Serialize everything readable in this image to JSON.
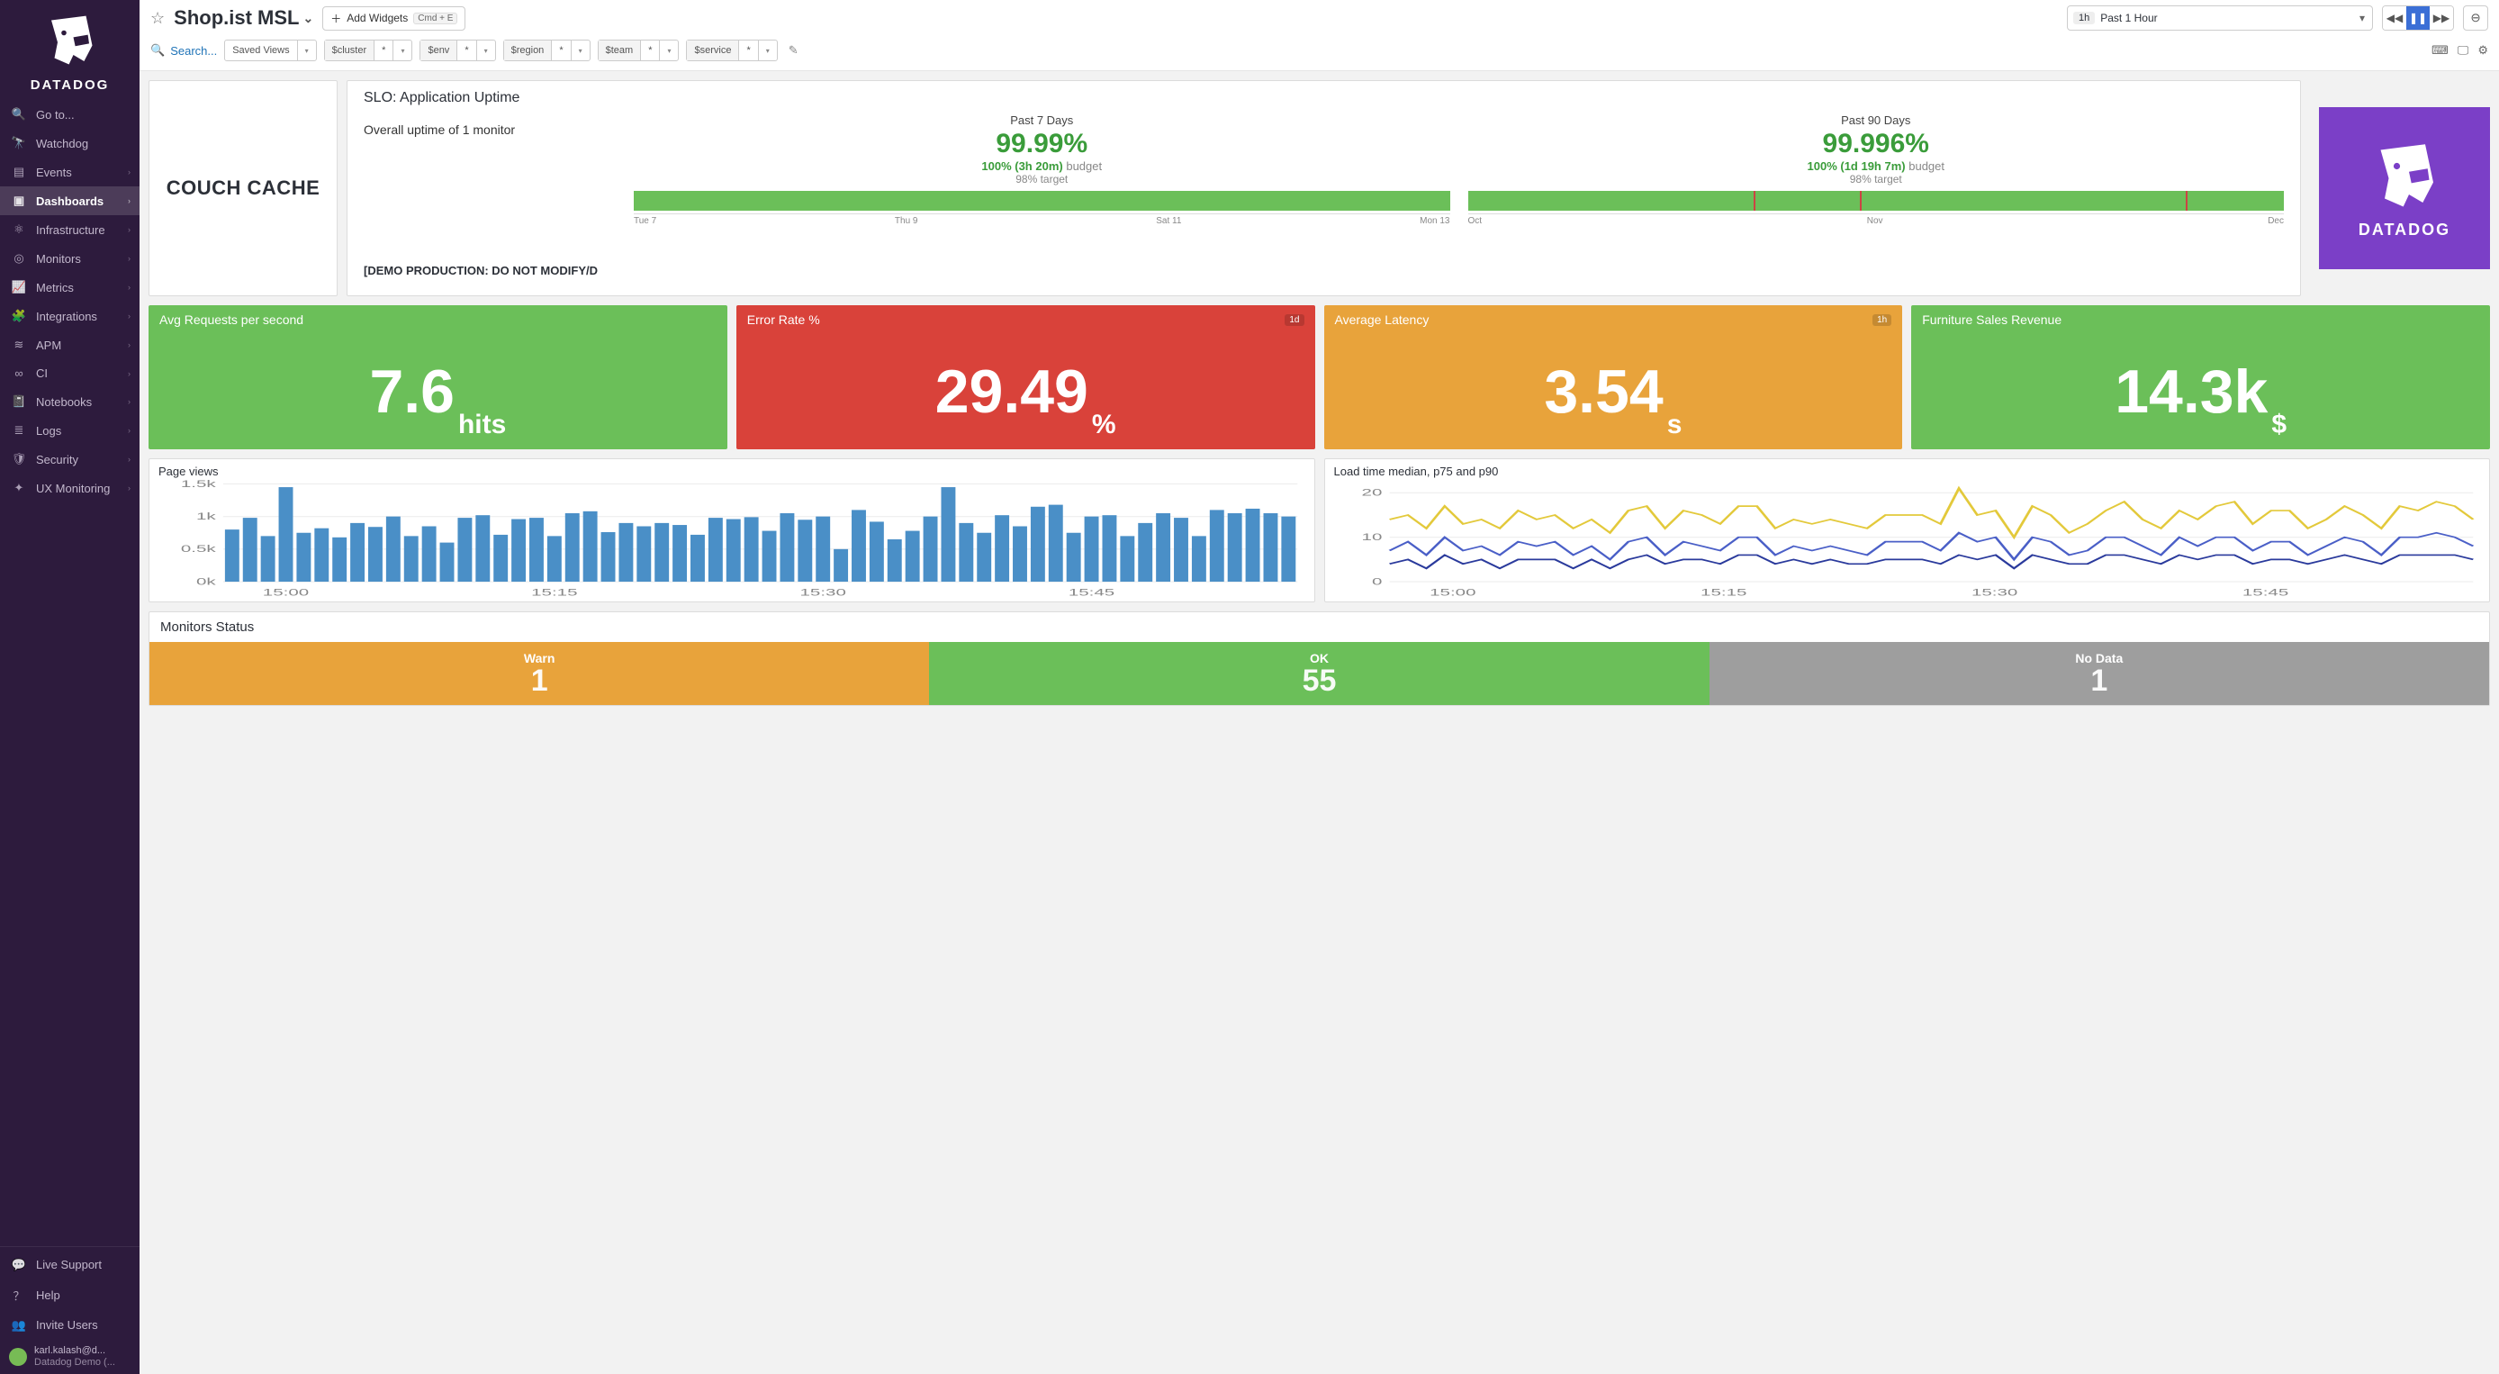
{
  "brand": "DATADOG",
  "sidebar": {
    "items": [
      {
        "label": "Go to...",
        "icon": "search",
        "chev": false
      },
      {
        "label": "Watchdog",
        "icon": "binoculars",
        "chev": false
      },
      {
        "label": "Events",
        "icon": "list",
        "chev": true
      },
      {
        "label": "Dashboards",
        "icon": "dashboard",
        "chev": true,
        "active": true
      },
      {
        "label": "Infrastructure",
        "icon": "infra",
        "chev": true
      },
      {
        "label": "Monitors",
        "icon": "monitor",
        "chev": true
      },
      {
        "label": "Metrics",
        "icon": "metrics",
        "chev": true
      },
      {
        "label": "Integrations",
        "icon": "puzzle",
        "chev": true
      },
      {
        "label": "APM",
        "icon": "apm",
        "chev": true
      },
      {
        "label": "CI",
        "icon": "ci",
        "chev": true
      },
      {
        "label": "Notebooks",
        "icon": "notebook",
        "chev": true
      },
      {
        "label": "Logs",
        "icon": "logs",
        "chev": true
      },
      {
        "label": "Security",
        "icon": "shield",
        "chev": true
      },
      {
        "label": "UX Monitoring",
        "icon": "ux",
        "chev": true
      }
    ],
    "footer": [
      {
        "label": "Live Support",
        "icon": "chat"
      },
      {
        "label": "Help",
        "icon": "help"
      },
      {
        "label": "Invite Users",
        "icon": "invite"
      }
    ],
    "user": {
      "name": "karl.kalash@d...",
      "org": "Datadog Demo (..."
    }
  },
  "header": {
    "title": "Shop.ist MSL",
    "add_widgets": "Add Widgets",
    "add_widgets_kbd": "Cmd + E",
    "time_badge": "1h",
    "time_label": "Past 1 Hour",
    "search": "Search...",
    "saved_views": "Saved Views",
    "vars": [
      {
        "name": "$cluster",
        "val": "*"
      },
      {
        "name": "$env",
        "val": "*"
      },
      {
        "name": "$region",
        "val": "*"
      },
      {
        "name": "$team",
        "val": "*"
      },
      {
        "name": "$service",
        "val": "*"
      }
    ]
  },
  "logo_card": "COUCH CACHE",
  "slo": {
    "title": "SLO: Application Uptime",
    "overall": "Overall uptime of 1 monitor",
    "demo": "[DEMO PRODUCTION: DO NOT MODIFY/D",
    "cols": [
      {
        "title": "Past 7 Days",
        "pct": "99.99%",
        "budget_g": "100% (3h 20m)",
        "budget_b": "budget",
        "target": "98% target",
        "axis": [
          "Tue 7",
          "Thu 9",
          "Sat 11",
          "Mon 13"
        ],
        "ticks": []
      },
      {
        "title": "Past 90 Days",
        "pct": "99.996%",
        "budget_g": "100% (1d 19h 7m)",
        "budget_b": "budget",
        "target": "98% target",
        "axis": [
          "Oct",
          "Nov",
          "Dec"
        ],
        "ticks": [
          0.35,
          0.48,
          0.88
        ]
      }
    ]
  },
  "bigcards": [
    {
      "title": "Avg Requests per second",
      "value": "7.6",
      "unit": "hits",
      "color": "green",
      "badge": ""
    },
    {
      "title": "Error Rate %",
      "value": "29.49",
      "unit": "%",
      "color": "red",
      "badge": "1d"
    },
    {
      "title": "Average Latency",
      "value": "3.54",
      "unit": "s",
      "color": "orange",
      "badge": "1h"
    },
    {
      "title": "Furniture Sales Revenue",
      "value": "14.3k",
      "unit": "$",
      "color": "green",
      "badge": ""
    }
  ],
  "monitors": {
    "title": "Monitors Status",
    "cells": [
      {
        "label": "Warn",
        "value": "1",
        "color": "warn"
      },
      {
        "label": "OK",
        "value": "55",
        "color": "ok"
      },
      {
        "label": "No Data",
        "value": "1",
        "color": "nodata"
      }
    ]
  },
  "chart_data": [
    {
      "id": "page_views",
      "type": "bar",
      "title": "Page views",
      "xlabel": "",
      "ylabel": "",
      "ylim": [
        0,
        1500
      ],
      "yticks": [
        0,
        500,
        1000,
        1500
      ],
      "ytick_labels": [
        "0k",
        "0.5k",
        "1k",
        "1.5k"
      ],
      "x_tick_labels": [
        "15:00",
        "15:15",
        "15:30",
        "15:45"
      ],
      "categories": [
        "14:58",
        "14:59",
        "15:00",
        "15:01",
        "15:02",
        "15:03",
        "15:04",
        "15:05",
        "15:06",
        "15:07",
        "15:08",
        "15:09",
        "15:10",
        "15:11",
        "15:12",
        "15:13",
        "15:14",
        "15:15",
        "15:16",
        "15:17",
        "15:18",
        "15:19",
        "15:20",
        "15:21",
        "15:22",
        "15:23",
        "15:24",
        "15:25",
        "15:26",
        "15:27",
        "15:28",
        "15:29",
        "15:30",
        "15:31",
        "15:32",
        "15:33",
        "15:34",
        "15:35",
        "15:36",
        "15:37",
        "15:38",
        "15:39",
        "15:40",
        "15:41",
        "15:42",
        "15:43",
        "15:44",
        "15:45",
        "15:46",
        "15:47",
        "15:48",
        "15:49",
        "15:50",
        "15:51",
        "15:52",
        "15:53",
        "15:54",
        "15:55",
        "15:56",
        "15:57"
      ],
      "values": [
        800,
        980,
        700,
        1450,
        750,
        820,
        680,
        900,
        840,
        1000,
        700,
        850,
        600,
        980,
        1020,
        720,
        960,
        980,
        700,
        1050,
        1080,
        760,
        900,
        850,
        900,
        870,
        720,
        980,
        960,
        990,
        780,
        1050,
        950,
        1000,
        500,
        1100,
        920,
        650,
        780,
        1000,
        1450,
        900,
        750,
        1020,
        850,
        1150,
        1180,
        750,
        1000,
        1020,
        700,
        900,
        1050,
        980,
        700,
        1100,
        1050,
        1120,
        1050,
        1000
      ]
    },
    {
      "id": "load_time",
      "type": "line",
      "title": "Load time median, p75 and p90",
      "xlabel": "",
      "ylabel": "",
      "ylim": [
        0,
        22
      ],
      "yticks": [
        0,
        10,
        20
      ],
      "x_tick_labels": [
        "15:00",
        "15:15",
        "15:30",
        "15:45"
      ],
      "x": [
        0,
        1,
        2,
        3,
        4,
        5,
        6,
        7,
        8,
        9,
        10,
        11,
        12,
        13,
        14,
        15,
        16,
        17,
        18,
        19,
        20,
        21,
        22,
        23,
        24,
        25,
        26,
        27,
        28,
        29,
        30,
        31,
        32,
        33,
        34,
        35,
        36,
        37,
        38,
        39,
        40,
        41,
        42,
        43,
        44,
        45,
        46,
        47,
        48,
        49,
        50,
        51,
        52,
        53,
        54,
        55,
        56,
        57,
        58,
        59
      ],
      "series": [
        {
          "name": "p90",
          "color": "#e3c93b",
          "values": [
            14,
            15,
            12,
            17,
            13,
            14,
            12,
            16,
            14,
            15,
            12,
            14,
            11,
            16,
            17,
            12,
            16,
            15,
            13,
            17,
            17,
            12,
            14,
            13,
            14,
            13,
            12,
            15,
            15,
            15,
            13,
            21,
            15,
            16,
            10,
            17,
            15,
            11,
            13,
            16,
            18,
            14,
            12,
            16,
            14,
            17,
            18,
            13,
            16,
            16,
            12,
            14,
            17,
            15,
            12,
            17,
            16,
            18,
            17,
            14
          ]
        },
        {
          "name": "p75",
          "color": "#4a5fc7",
          "values": [
            7,
            9,
            6,
            10,
            7,
            8,
            6,
            9,
            8,
            9,
            6,
            8,
            5,
            9,
            10,
            6,
            9,
            8,
            7,
            10,
            10,
            6,
            8,
            7,
            8,
            7,
            6,
            9,
            9,
            9,
            7,
            11,
            9,
            10,
            5,
            10,
            9,
            6,
            7,
            10,
            10,
            8,
            6,
            10,
            8,
            10,
            10,
            7,
            9,
            9,
            6,
            8,
            10,
            9,
            6,
            10,
            10,
            11,
            10,
            8
          ]
        },
        {
          "name": "median",
          "color": "#2a3a9c",
          "values": [
            4,
            5,
            3,
            6,
            4,
            5,
            3,
            5,
            5,
            5,
            3,
            5,
            3,
            5,
            6,
            4,
            5,
            5,
            4,
            6,
            6,
            4,
            5,
            4,
            5,
            4,
            4,
            5,
            5,
            5,
            4,
            6,
            5,
            6,
            3,
            6,
            5,
            4,
            4,
            6,
            6,
            5,
            4,
            6,
            5,
            6,
            6,
            4,
            5,
            5,
            4,
            5,
            6,
            5,
            4,
            6,
            6,
            6,
            6,
            5
          ]
        }
      ]
    }
  ]
}
